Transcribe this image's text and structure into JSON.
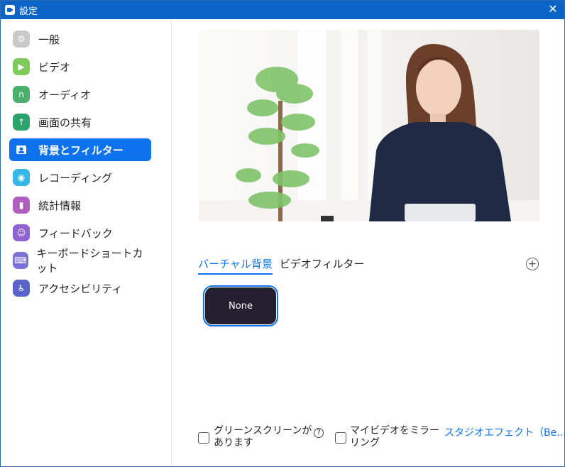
{
  "window": {
    "title": "設定"
  },
  "sidebar": {
    "items": [
      {
        "label": "一般",
        "icon": "gear-icon",
        "color": "#c9c9c9"
      },
      {
        "label": "ビデオ",
        "icon": "video-icon",
        "color": "#7ecb5c"
      },
      {
        "label": "オーディオ",
        "icon": "headphones-icon",
        "color": "#4caf6e"
      },
      {
        "label": "画面の共有",
        "icon": "share-screen-icon",
        "color": "#2ca36a"
      },
      {
        "label": "背景とフィルター",
        "icon": "background-filter-icon",
        "color": "#ffffff",
        "active": true
      },
      {
        "label": "レコーディング",
        "icon": "record-icon",
        "color": "#37b6e8"
      },
      {
        "label": "統計情報",
        "icon": "stats-icon",
        "color": "#b05fbf"
      },
      {
        "label": "フィードバック",
        "icon": "feedback-icon",
        "color": "#8f63d2"
      },
      {
        "label": "キーボードショートカット",
        "icon": "keyboard-icon",
        "color": "#7c72d6"
      },
      {
        "label": "アクセシビリティ",
        "icon": "accessibility-icon",
        "color": "#5a64c8"
      }
    ]
  },
  "main": {
    "tabs": [
      {
        "label": "バーチャル背景",
        "active": true
      },
      {
        "label": "ビデオフィルター",
        "active": false
      }
    ],
    "background_options": [
      {
        "label": "None",
        "selected": true
      }
    ],
    "footer": {
      "green_screen_label": "グリーンスクリーンがあります",
      "mirror_label": "マイビデオをミラーリング",
      "studio_effects_label": "スタジオエフェクト（Be..."
    }
  },
  "colors": {
    "accent": "#0e72ed",
    "titlebar": "#0d64c7"
  }
}
